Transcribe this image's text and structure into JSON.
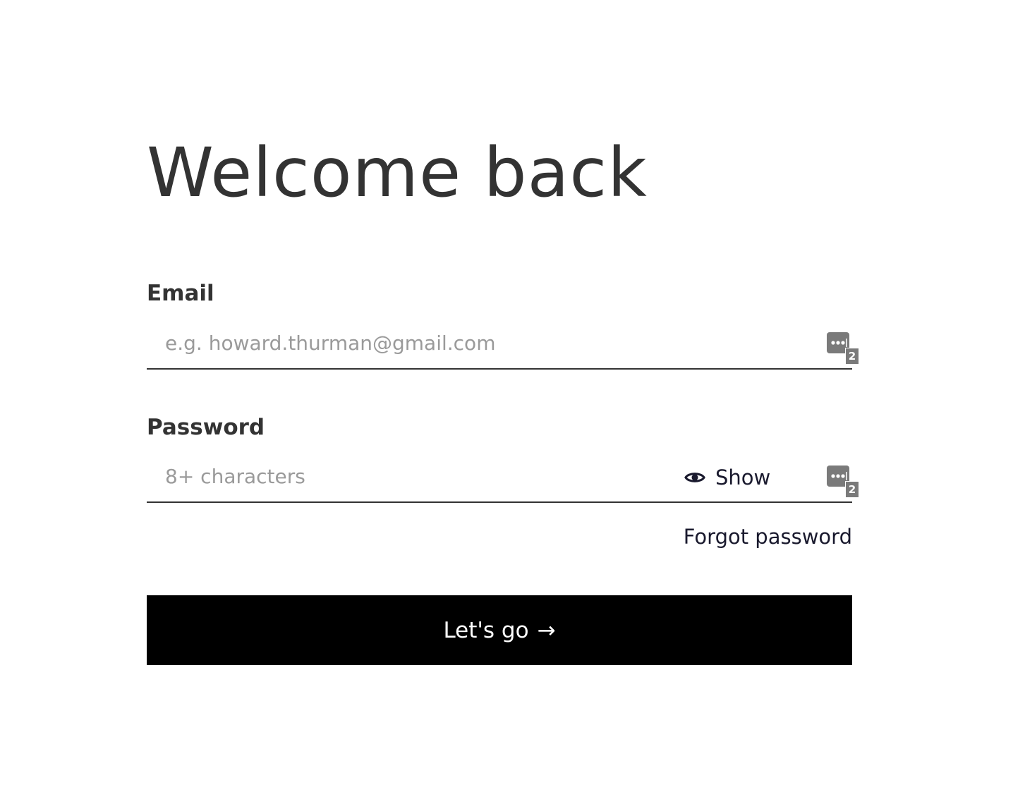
{
  "page": {
    "title": "Welcome back"
  },
  "form": {
    "email": {
      "label": "Email",
      "placeholder": "e.g. howard.thurman@gmail.com",
      "value": "",
      "password_manager_count": "2"
    },
    "password": {
      "label": "Password",
      "placeholder": "8+ characters",
      "value": "",
      "show_label": "Show",
      "password_manager_count": "2"
    },
    "forgot_password_label": "Forgot password",
    "submit_label": "Let's go",
    "submit_arrow": "→"
  },
  "icons": {
    "eye": "eye-icon",
    "password_manager": "password-manager-icon",
    "arrow": "arrow-right-icon"
  },
  "colors": {
    "background": "#ffffff",
    "text": "#333333",
    "placeholder": "#9a9a9a",
    "button_bg": "#000000",
    "button_text": "#ffffff",
    "underline": "#333333",
    "password_manager_icon": "#7a7a7a"
  }
}
